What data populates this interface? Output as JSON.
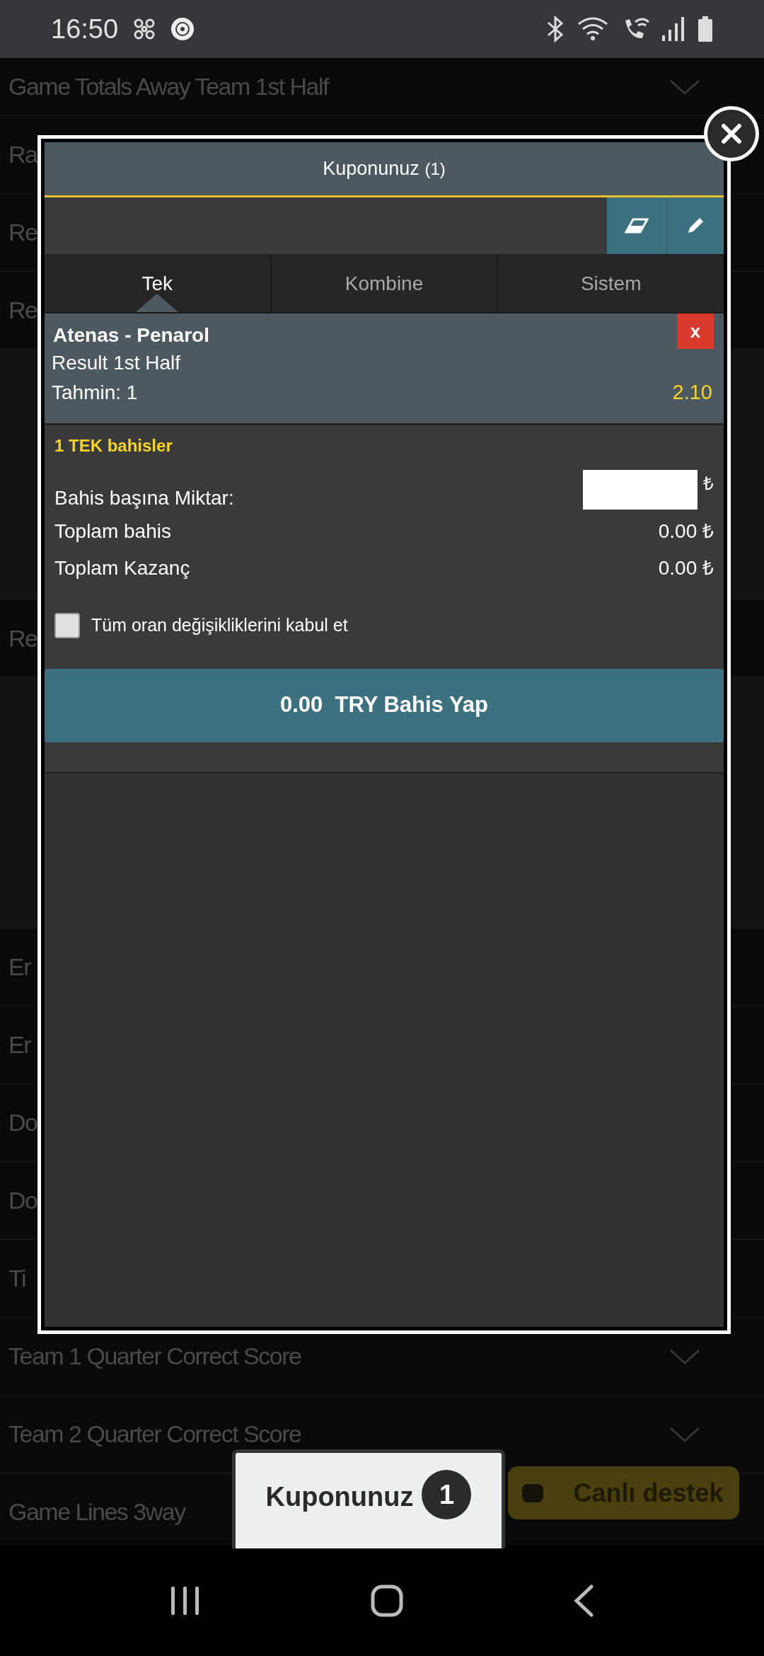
{
  "status_bar": {
    "time": "16:50"
  },
  "markets": [
    {
      "kind": "partial_row",
      "label": "Game Totals Away Team 1st Half",
      "chevron": true
    },
    {
      "kind": "row",
      "label": "Ra"
    },
    {
      "kind": "row",
      "label": "Re"
    },
    {
      "kind": "row",
      "label": "Re"
    },
    {
      "kind": "panel"
    },
    {
      "kind": "row",
      "label": "Re"
    },
    {
      "kind": "panel"
    },
    {
      "kind": "row",
      "label": "Er"
    },
    {
      "kind": "row",
      "label": "Er"
    },
    {
      "kind": "row",
      "label": "Do"
    },
    {
      "kind": "row",
      "label": "Do"
    },
    {
      "kind": "row",
      "label": "Ti"
    },
    {
      "kind": "row",
      "label": "Team 1 Quarter Correct Score",
      "chevron": true
    },
    {
      "kind": "row",
      "label": "Team 2 Quarter Correct Score",
      "chevron": true
    },
    {
      "kind": "row",
      "label": "Game Lines 3way"
    }
  ],
  "coupon": {
    "title": "Kuponunuz",
    "count": "(1)",
    "tabs": [
      {
        "label": "Tek",
        "selected": true
      },
      {
        "label": "Kombine",
        "selected": false
      },
      {
        "label": "Sistem",
        "selected": false
      }
    ],
    "bet": {
      "match": "Atenas - Penarol",
      "market": "Result 1st Half",
      "pick": "Tahmin: 1",
      "odds": "2.10",
      "remove": "x"
    },
    "section_title": "1 TEK bahisler",
    "stake_label": "Bahis başına Miktar:",
    "currency": "₺",
    "totals": [
      {
        "label": "Toplam bahis",
        "value": "0.00 ₺"
      },
      {
        "label": "Toplam Kazanç",
        "value": "0.00 ₺"
      }
    ],
    "accept_changes": {
      "label": "Tüm oran değişikliklerini kabul et",
      "checked": false
    },
    "place_bet": "0.00  TRY Bahis Yap"
  },
  "coupon_tab": {
    "label": "Kuponunuz",
    "badge": "1"
  },
  "support_button": "Canlı destek"
}
